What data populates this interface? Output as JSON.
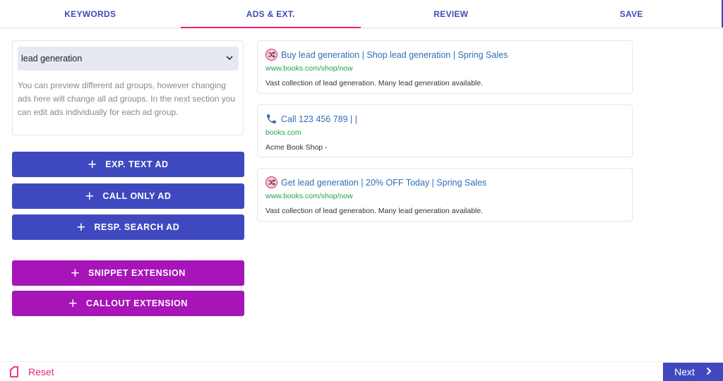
{
  "tabs": [
    {
      "label": "KEYWORDS"
    },
    {
      "label": "ADS & EXT."
    },
    {
      "label": "REVIEW"
    },
    {
      "label": "SAVE"
    }
  ],
  "active_tab": "ADS & EXT.",
  "ad_group": {
    "selected": "lead generation",
    "note": "You can preview different ad groups, however changing ads here will change all ad groups. In the next section you can edit ads individually for each ad group."
  },
  "buttons": {
    "exp_text_ad": "EXP. TEXT AD",
    "call_only_ad": "CALL ONLY AD",
    "resp_search_ad": "RESP. SEARCH AD",
    "snippet_extension": "SNIPPET EXTENSION",
    "callout_extension": "CALLOUT EXTENSION"
  },
  "ads": [
    {
      "icon": "shuffle-icon",
      "headline": "Buy lead generation | Shop lead generation | Spring Sales",
      "url": "www.books.com/shop/now",
      "description": "Vast collection of lead generation. Many lead generation available."
    },
    {
      "icon": "phone-icon",
      "headline": "Call 123 456 789 | |",
      "url": "books.com",
      "description": "Acme Book Shop -"
    },
    {
      "icon": "shuffle-icon",
      "headline": "Get lead generation | 20% OFF Today | Spring Sales",
      "url": "www.books.com/shop/now",
      "description": "Vast collection of lead generation. Many lead generation available."
    }
  ],
  "footer": {
    "reset": "Reset",
    "next": "Next"
  },
  "colors": {
    "primary": "#3f49bf",
    "extension": "#a714b8",
    "accent": "#e8266d",
    "link": "#2d6fb6",
    "url": "#1aa64a"
  }
}
